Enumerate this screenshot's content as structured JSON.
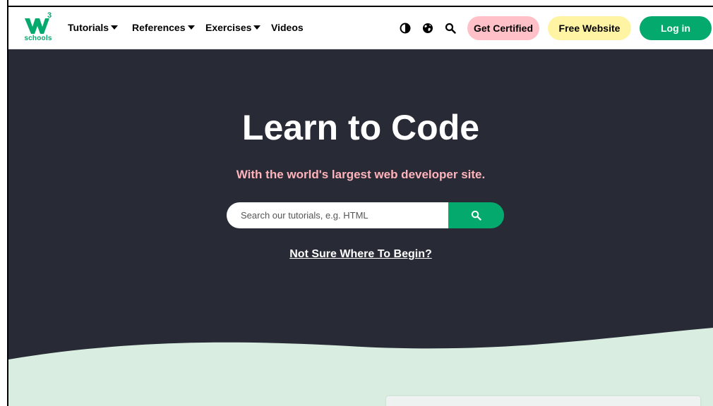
{
  "brand": {
    "logo_sup": "3",
    "logo_text": "schools"
  },
  "nav": {
    "tutorials": "Tutorials",
    "references": "References",
    "exercises": "Exercises",
    "videos": "Videos"
  },
  "actions": {
    "get_certified": "Get Certified",
    "free_website": "Free Website",
    "log_in": "Log in"
  },
  "icons": {
    "theme": "contrast-icon",
    "language": "globe-icon",
    "search": "search-icon",
    "dropdown": "caret-down-icon"
  },
  "hero": {
    "title": "Learn to Code",
    "subtitle": "With the world's largest web developer site.",
    "search_placeholder": "Search our tutorials, e.g. HTML",
    "begin_link": "Not Sure Where To Begin?"
  },
  "colors": {
    "brand_green": "#04aa6d",
    "hero_bg": "#282a35",
    "subtitle_pink": "#ffb3bb",
    "certified_bg": "#ffc0c7",
    "free_website_bg": "#fff4a3",
    "wave_mint": "#d9eee1"
  }
}
